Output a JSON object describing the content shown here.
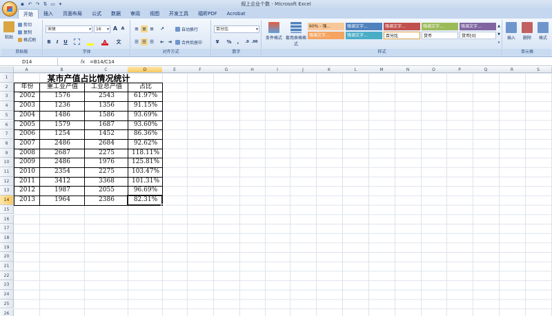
{
  "app": {
    "title": "规上企业个数 - Microsoft Excel"
  },
  "ribbon_tabs": [
    "开始",
    "插入",
    "页面布局",
    "公式",
    "数据",
    "审阅",
    "视图",
    "开发工具",
    "福昕PDF",
    "Acrobat"
  ],
  "ribbon": {
    "clipboard": {
      "label": "剪贴板",
      "paste": "粘贴",
      "cut": "剪切",
      "copy": "复制",
      "format_painter": "格式刷"
    },
    "font": {
      "label": "字体",
      "font_name": "宋体",
      "font_size": "16",
      "grow": "A",
      "shrink": "A",
      "bold": "B",
      "italic": "I",
      "underline": "U",
      "font_color_letter": "A"
    },
    "alignment": {
      "label": "对齐方式",
      "wrap": "自动换行",
      "merge": "合并后居中"
    },
    "number": {
      "label": "数字",
      "format": "百分比",
      "percent": "%",
      "comma": ","
    },
    "styles": {
      "label": "样式",
      "conditional": "条件格式",
      "table": "套用表格格式",
      "cells": [
        "60% - 强...",
        "强调文字...",
        "强调文字...",
        "强调文字...",
        "强调文字...",
        "强调文字...",
        "强调文字...",
        "百分比",
        "货币",
        "货币[0]"
      ]
    },
    "cells": {
      "label": "单元格",
      "insert": "插入",
      "delete": "删除",
      "format": "格式"
    }
  },
  "formula_bar": {
    "name_box": "D14",
    "fx": "fx",
    "formula": "=B14/C14"
  },
  "columns": [
    "A",
    "B",
    "C",
    "D",
    "E",
    "F",
    "G",
    "H",
    "I",
    "J",
    "K",
    "L",
    "M",
    "N",
    "O",
    "P",
    "Q",
    "R",
    "S"
  ],
  "rows": [
    "1",
    "2",
    "3",
    "4",
    "5",
    "6",
    "7",
    "8",
    "9",
    "10",
    "11",
    "12",
    "13",
    "14",
    "15",
    "16",
    "17",
    "18",
    "19",
    "20",
    "21",
    "22",
    "23",
    "24",
    "25",
    "26"
  ],
  "sheet": {
    "title": "某市产值占比情况统计",
    "headers": [
      "年份",
      "重工业产值",
      "工业总产值",
      "占比"
    ],
    "data": [
      [
        "2002",
        "1576",
        "2543",
        "61.97%"
      ],
      [
        "2003",
        "1236",
        "1356",
        "91.15%"
      ],
      [
        "2004",
        "1486",
        "1586",
        "93.69%"
      ],
      [
        "2005",
        "1579",
        "1687",
        "93.60%"
      ],
      [
        "2006",
        "1254",
        "1452",
        "86.36%"
      ],
      [
        "2007",
        "2486",
        "2684",
        "92.62%"
      ],
      [
        "2008",
        "2687",
        "2275",
        "118.11%"
      ],
      [
        "2009",
        "2486",
        "1976",
        "125.81%"
      ],
      [
        "2010",
        "2354",
        "2275",
        "103.47%"
      ],
      [
        "2011",
        "3412",
        "3368",
        "101.31%"
      ],
      [
        "2012",
        "1987",
        "2055",
        "96.69%"
      ],
      [
        "2013",
        "1964",
        "2386",
        "82.31%"
      ]
    ]
  },
  "colors": {
    "ribbon_bg": "#dde8f6",
    "selection_header": "#f8c860",
    "style_orange": "#f4a460",
    "style_blue": "#4f81bd",
    "style_red": "#c0504d",
    "style_green": "#9bbb59",
    "style_purple": "#8064a2",
    "style_teal": "#4bacc6"
  }
}
